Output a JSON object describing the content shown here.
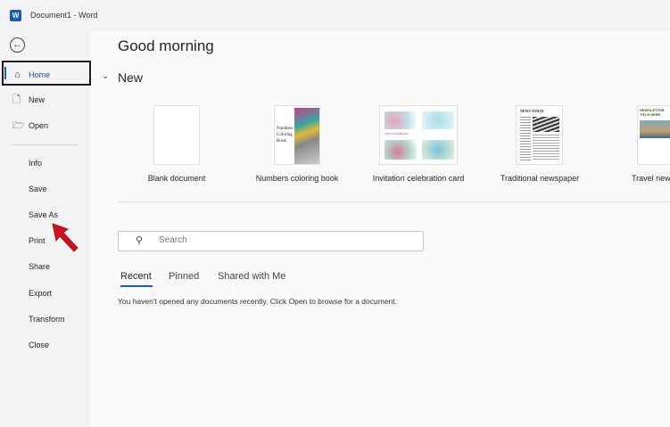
{
  "window": {
    "title": "Document1  -  Word",
    "app_icon": "word-logo"
  },
  "sidebar": {
    "back_icon": "back-arrow-circle-icon",
    "items": [
      {
        "label": "Home",
        "icon": "home-icon",
        "active": true
      },
      {
        "label": "New",
        "icon": "new-document-icon"
      },
      {
        "label": "Open",
        "icon": "folder-open-icon"
      },
      {
        "label": "Info"
      },
      {
        "label": "Save"
      },
      {
        "label": "Save As"
      },
      {
        "label": "Print"
      },
      {
        "label": "Share"
      },
      {
        "label": "Export"
      },
      {
        "label": "Transform"
      },
      {
        "label": "Close"
      }
    ]
  },
  "main": {
    "greeting": "Good morning",
    "new_section": "New",
    "templates": [
      {
        "label": "Blank document"
      },
      {
        "label": "Numbers coloring book",
        "thumb_text": "Numbers Coloring Book"
      },
      {
        "label": "Invitation celebration card",
        "thumb_text": "LET'S CELEBRATE"
      },
      {
        "label": "Traditional newspaper",
        "thumb_text": "NEWS TODAY"
      },
      {
        "label": "Travel newsletter",
        "thumb_text": "NEWSLETTER TITLE HERE"
      }
    ],
    "search": {
      "placeholder": "Search",
      "icon": "search-icon"
    },
    "tabs": [
      {
        "label": "Recent",
        "active": true
      },
      {
        "label": "Pinned"
      },
      {
        "label": "Shared with Me"
      }
    ],
    "empty_message": "You haven't opened any documents recently. Click Open to browse for a document."
  },
  "colors": {
    "accent": "#185abd",
    "cursor_arrow": "#d0101a"
  }
}
